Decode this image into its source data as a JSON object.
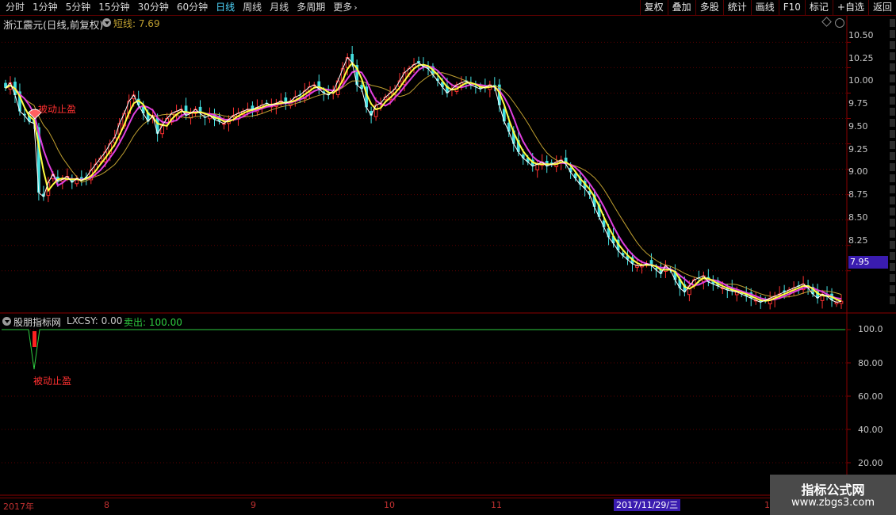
{
  "toolbar": {
    "tabs": [
      "分时",
      "1分钟",
      "5分钟",
      "15分钟",
      "30分钟",
      "60分钟",
      "日线",
      "周线",
      "月线",
      "多周期"
    ],
    "active_tab": "日线",
    "more_label": "更多",
    "tools": [
      "复权",
      "叠加",
      "多股",
      "统计",
      "画线",
      "F10",
      "标记",
      "+自选",
      "返回"
    ]
  },
  "chart_header": {
    "title": "浙江震元(日线,前复权)",
    "ma_label": "短线: 7.69"
  },
  "price_axis": {
    "ticks": [
      "10.50",
      "10.25",
      "10.00",
      "9.75",
      "9.50",
      "9.25",
      "9.00",
      "8.75",
      "8.50",
      "8.25"
    ],
    "current_price": "7.95"
  },
  "annotation": {
    "main_text": "被动止盈",
    "sub_text": "被动止盈"
  },
  "indicator": {
    "name": "股朋指标网",
    "value1": "LXCSY: 0.00",
    "value2": "卖出: 100.00",
    "ticks": [
      "100.0",
      "80.00",
      "60.00",
      "40.00",
      "20.00"
    ]
  },
  "date_axis": {
    "labels": [
      "2017年",
      "8",
      "9",
      "10",
      "11",
      "1"
    ],
    "cursor_date": "2017/11/29/三"
  },
  "watermark": {
    "line1": "指标公式网",
    "line2": "www.zbgs3.com"
  },
  "colors": {
    "up": "#ff3030",
    "down": "#44e0e0",
    "ma_short": "#ffff40",
    "ma_mid": "#e040e0",
    "ma_long": "#c0a030",
    "grid": "#5a0000",
    "line": "#2ecc40"
  },
  "chart_data": {
    "type": "candlestick",
    "ylim": [
      7.85,
      10.62
    ],
    "closes": [
      10.05,
      10.1,
      9.98,
      9.82,
      9.78,
      9.72,
      9.7,
      9.02,
      8.98,
      9.12,
      9.2,
      9.13,
      9.15,
      9.18,
      9.12,
      9.16,
      9.14,
      9.17,
      9.24,
      9.3,
      9.36,
      9.42,
      9.5,
      9.56,
      9.7,
      9.8,
      9.92,
      9.98,
      9.88,
      9.8,
      9.72,
      9.78,
      9.6,
      9.68,
      9.75,
      9.8,
      9.82,
      9.84,
      9.78,
      9.8,
      9.84,
      9.8,
      9.76,
      9.78,
      9.74,
      9.72,
      9.7,
      9.74,
      9.78,
      9.8,
      9.82,
      9.84,
      9.84,
      9.86,
      9.88,
      9.9,
      9.88,
      9.9,
      9.92,
      9.9,
      9.92,
      9.96,
      9.98,
      10.02,
      10.06,
      10.08,
      10.04,
      10.0,
      9.98,
      10.02,
      10.12,
      10.24,
      10.35,
      10.3,
      10.08,
      10.04,
      9.86,
      9.78,
      9.88,
      9.9,
      9.96,
      10.0,
      10.04,
      10.12,
      10.2,
      10.24,
      10.28,
      10.3,
      10.26,
      10.24,
      10.18,
      10.12,
      10.06,
      10.0,
      10.04,
      10.08,
      10.1,
      10.12,
      10.08,
      10.06,
      10.04,
      10.06,
      10.08,
      10.06,
      9.88,
      9.72,
      9.62,
      9.5,
      9.42,
      9.36,
      9.32,
      9.28,
      9.3,
      9.32,
      9.28,
      9.3,
      9.32,
      9.34,
      9.3,
      9.22,
      9.16,
      9.1,
      9.06,
      9.0,
      8.88,
      8.78,
      8.68,
      8.58,
      8.52,
      8.45,
      8.4,
      8.36,
      8.32,
      8.3,
      8.3,
      8.32,
      8.3,
      8.26,
      8.22,
      8.3,
      8.26,
      8.16,
      8.08,
      8.04,
      8.1,
      8.16,
      8.18,
      8.2,
      8.14,
      8.12,
      8.1,
      8.08,
      8.06,
      8.05,
      8.04,
      8.02,
      8.0,
      7.98,
      7.96,
      7.94,
      7.96,
      7.98,
      8.0,
      8.02,
      8.04,
      8.06,
      8.08,
      8.1,
      8.12,
      8.08,
      8.02,
      7.98,
      8.02,
      8.0,
      7.96,
      7.94,
      7.95
    ]
  }
}
